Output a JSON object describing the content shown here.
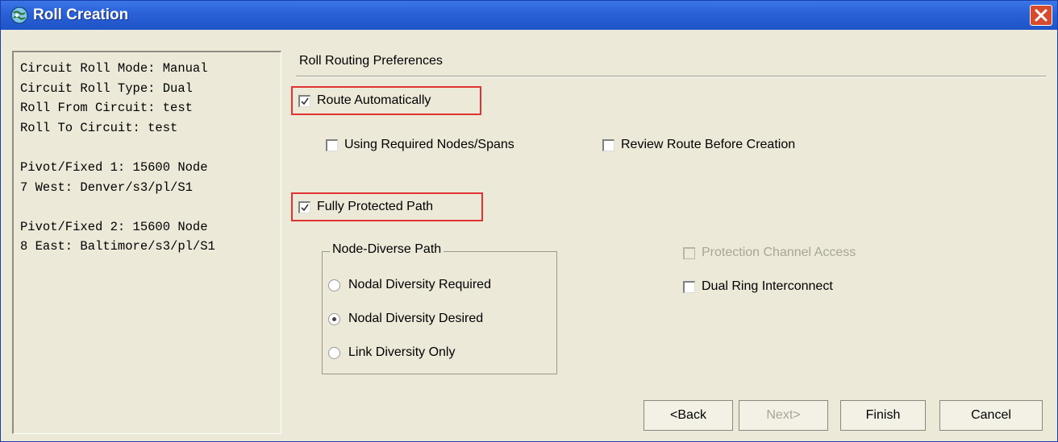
{
  "window": {
    "title": "Roll Creation",
    "title_icon": "globe-icon",
    "close_icon": "close-icon"
  },
  "summary_lines": [
    "Circuit Roll Mode: Manual",
    "Circuit Roll Type: Dual",
    "Roll From Circuit: test",
    "Roll To Circuit: test",
    "",
    "Pivot/Fixed 1: 15600 Node",
    "7 West: Denver/s3/pl/S1",
    "",
    "Pivot/Fixed 2: 15600 Node",
    "8 East: Baltimore/s3/pl/S1"
  ],
  "section": {
    "title": "Roll Routing Preferences"
  },
  "options": {
    "route_automatically": {
      "label": "Route Automatically",
      "checked": true
    },
    "using_required_nodes": {
      "label": "Using Required Nodes/Spans",
      "checked": false
    },
    "review_route": {
      "label": "Review Route Before Creation",
      "checked": false
    },
    "fully_protected_path": {
      "label": "Fully Protected Path",
      "checked": true
    },
    "protection_channel_access": {
      "label": "Protection Channel Access",
      "checked": false,
      "enabled": false
    },
    "dual_ring_interconnect": {
      "label": "Dual Ring Interconnect",
      "checked": false
    }
  },
  "node_diverse": {
    "title": "Node-Diverse Path",
    "choices": [
      {
        "label": "Nodal Diversity Required",
        "selected": false
      },
      {
        "label": "Nodal Diversity Desired",
        "selected": true
      },
      {
        "label": "Link Diversity Only",
        "selected": false
      }
    ]
  },
  "buttons": {
    "back": "<Back",
    "next": "Next>",
    "finish": "Finish",
    "cancel": "Cancel"
  },
  "colors": {
    "titlebar": "#2b62d8",
    "highlight": "#e23333",
    "background": "#ece9d8"
  }
}
